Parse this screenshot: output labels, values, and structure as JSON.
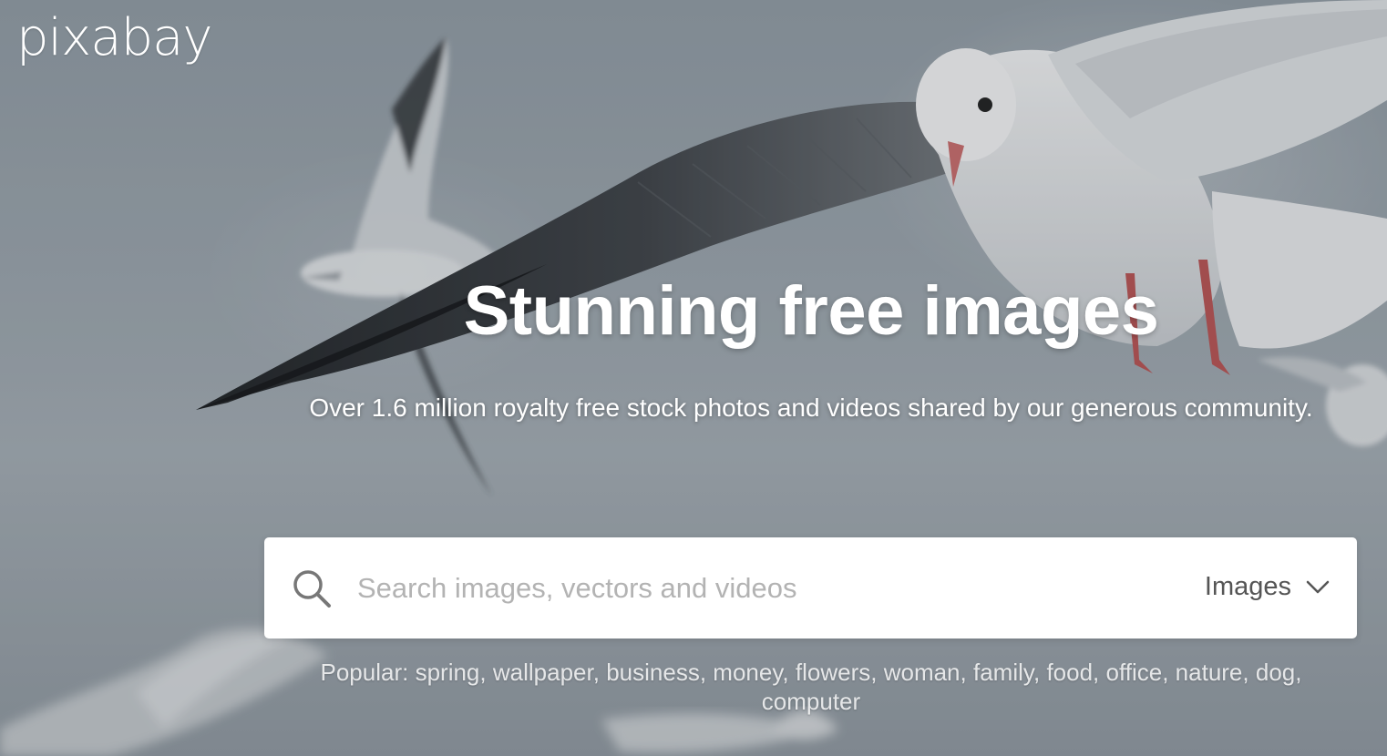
{
  "brand": {
    "logo_text": "pixabay"
  },
  "hero": {
    "title": "Stunning free images",
    "subtitle": "Over 1.6 million royalty free stock photos and videos shared by our generous community."
  },
  "search": {
    "placeholder": "Search images, vectors and videos",
    "value": "",
    "type_selected": "Images"
  },
  "popular": {
    "label": "Popular:",
    "tags": [
      "spring",
      "wallpaper",
      "business",
      "money",
      "flowers",
      "woman",
      "family",
      "food",
      "office",
      "nature",
      "dog",
      "computer"
    ]
  },
  "icons": {
    "search": "search-icon",
    "dropdown": "chevron-down-icon"
  },
  "colors": {
    "text_on_hero": "#ffffff",
    "search_bg": "#ffffff",
    "placeholder": "#b3b3b3",
    "select_text": "#555555"
  }
}
